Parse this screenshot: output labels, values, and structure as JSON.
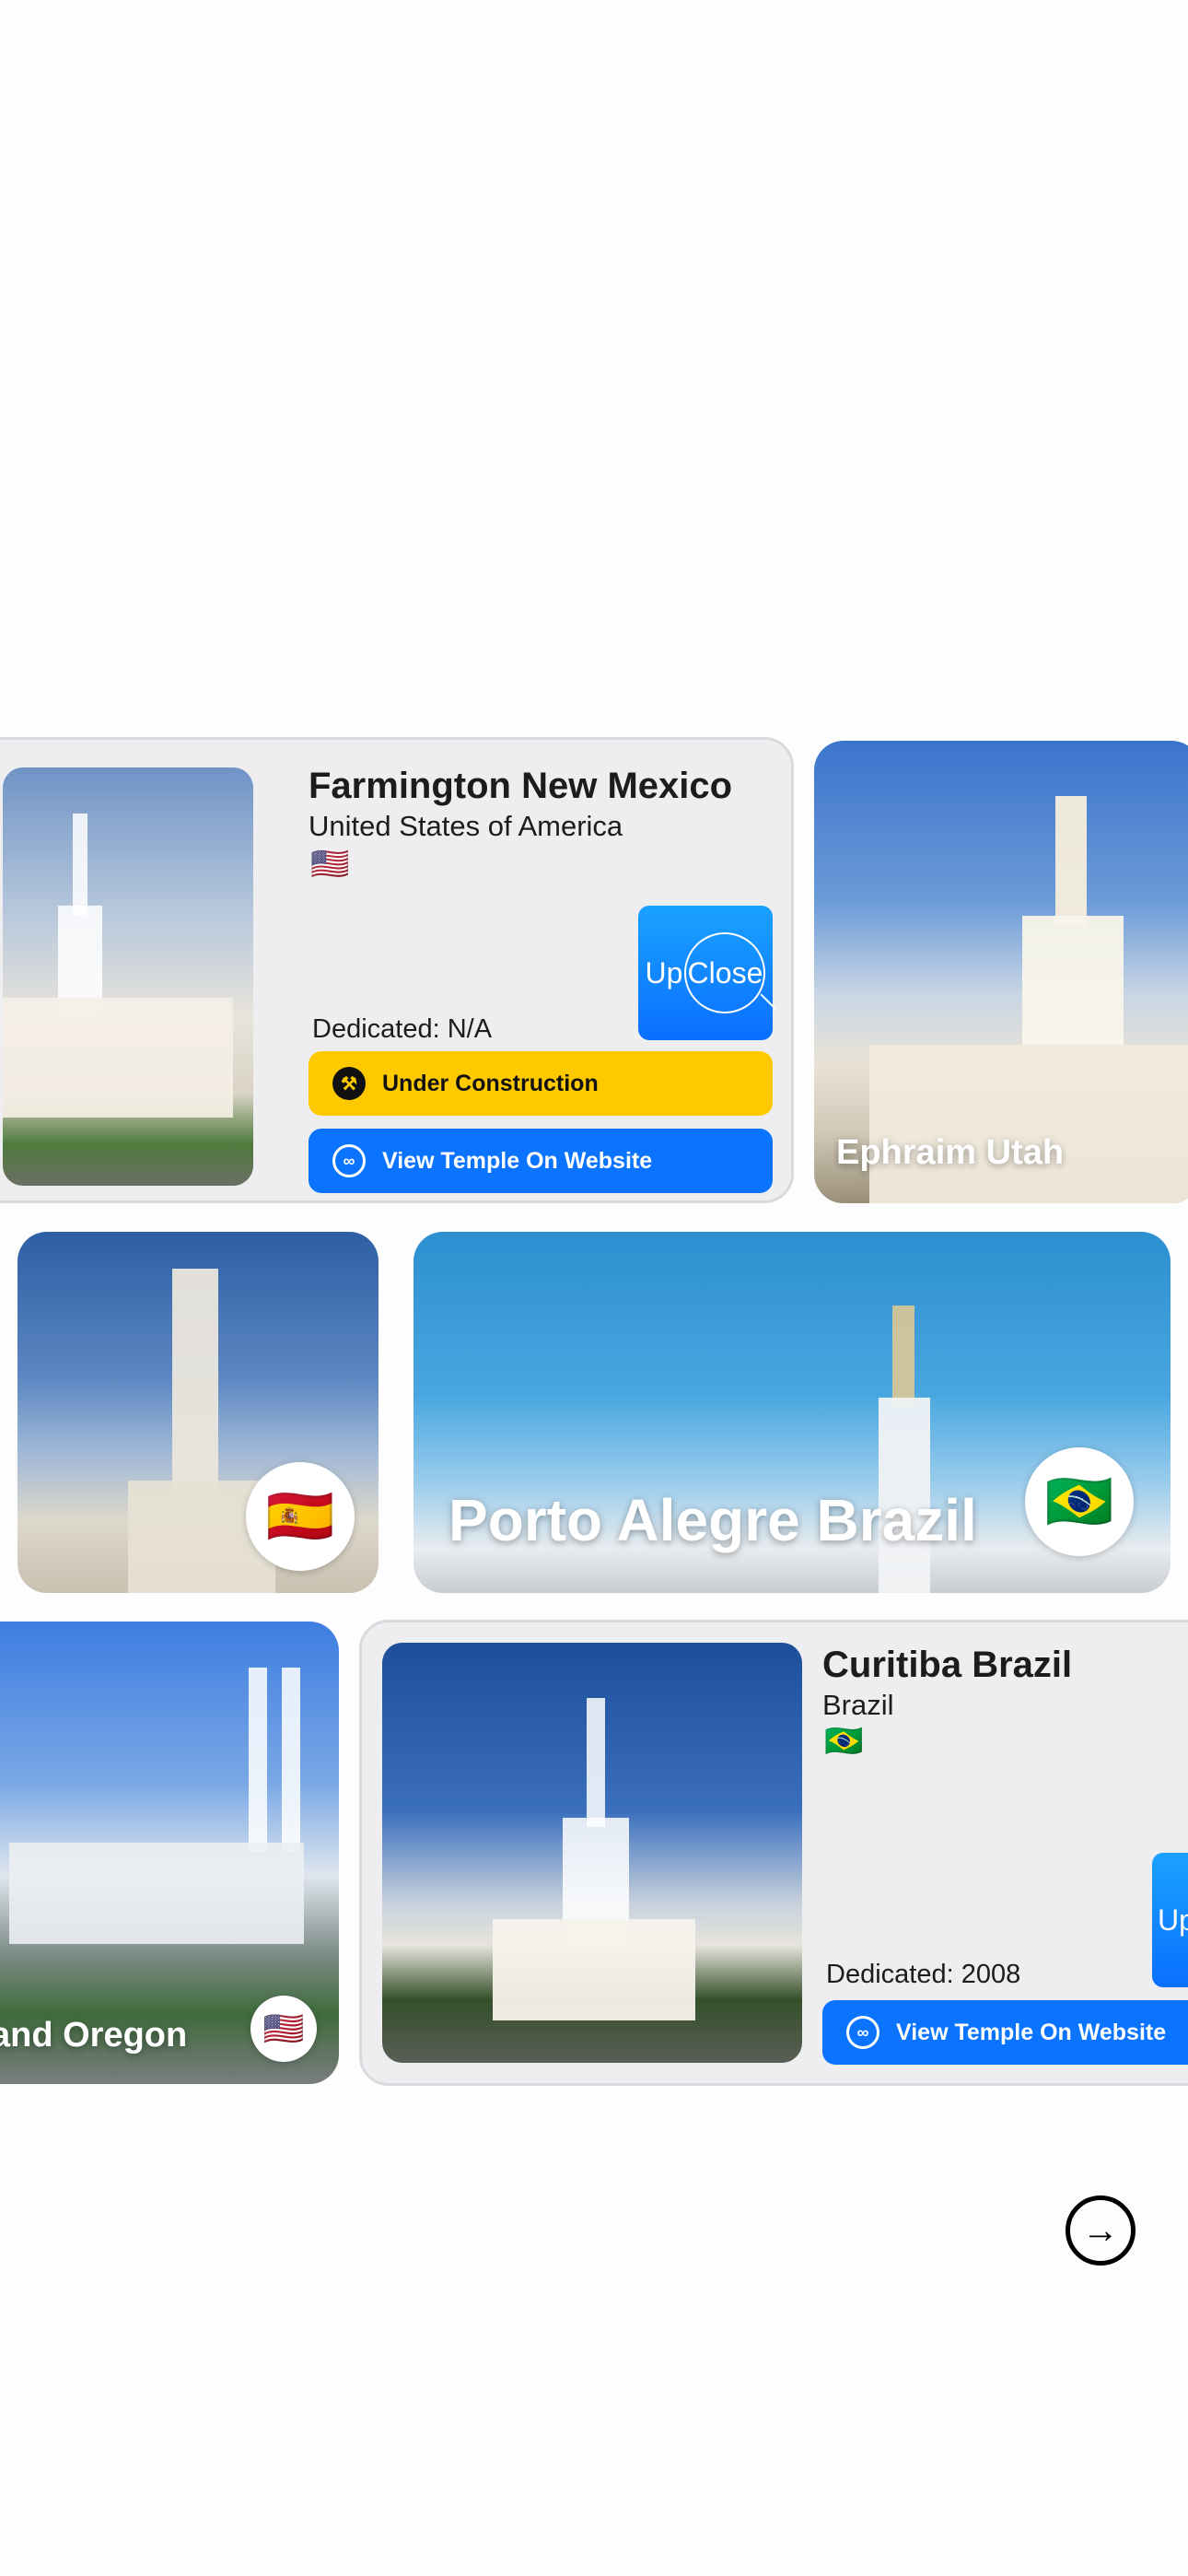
{
  "cards": {
    "farmington": {
      "title": "Farmington New Mexico",
      "country": "United States of America",
      "flag": "🇺🇸",
      "dedicated": "Dedicated: N/A",
      "status_label": "Under Construction",
      "website_label": "View Temple On Website",
      "upclose_up": "Up",
      "upclose_close": "Close"
    },
    "ephraim": {
      "label": "Ephraim Utah"
    },
    "spain": {
      "flag": "🇪🇸"
    },
    "porto_alegre": {
      "label": "Porto Alegre Brazil",
      "flag": "🇧🇷"
    },
    "portland": {
      "label": "and Oregon",
      "flag": "🇺🇸"
    },
    "curitiba": {
      "title": "Curitiba Brazil",
      "country": "Brazil",
      "flag": "🇧🇷",
      "dedicated": "Dedicated: 2008",
      "website_label": "View Temple On Website",
      "upclose_up": "Up"
    }
  },
  "navigation": {
    "next_icon": "arrow-right-circle-icon",
    "next_glyph": "→"
  },
  "colors": {
    "accent_blue": "#0a74ff",
    "status_yellow": "#ffc900",
    "card_bg": "#eeeef1"
  }
}
